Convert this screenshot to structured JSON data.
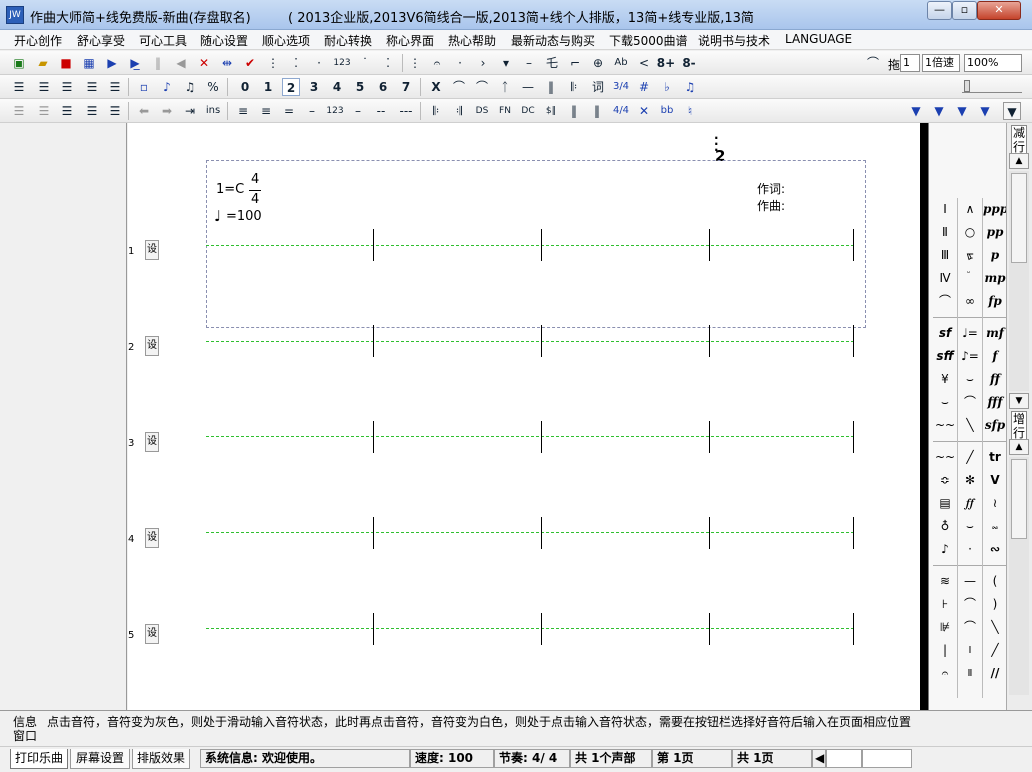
{
  "window": {
    "title": "作曲大师简+线免费版-新曲(存盘取名)",
    "title_extra": "( 2013企业版,2013V6简线合一版,2013简+线个人排版，13简+线专业版,13简",
    "controls": {
      "minimize": "—",
      "maximize": "▫",
      "close": "✕"
    },
    "icon_text": "JW"
  },
  "menu": [
    "开心创作",
    "舒心享受",
    "可心工具",
    "随心设置",
    "顺心选项",
    "耐心转换",
    "称心界面",
    "热心帮助",
    "最新动态与购买",
    "下载5000曲谱",
    "说明书与技术",
    "LANGUAGE"
  ],
  "toolbar1": {
    "drag_label": "拖",
    "drag_value": "1",
    "speed_value": "1倍速",
    "zoom_value": "100%",
    "buttons": [
      "123",
      "Ab",
      "8+",
      "8-"
    ]
  },
  "toolbar2": {
    "degrees": [
      "0",
      "1",
      "2",
      "3",
      "4",
      "5",
      "6",
      "7"
    ],
    "items": [
      "X",
      "词",
      "3/4",
      "#",
      "♭",
      "♫"
    ]
  },
  "toolbar3": {
    "items": [
      "ins",
      "123",
      "DS",
      "FN",
      "DC",
      "$‖",
      "4/4",
      "bb",
      "♮"
    ]
  },
  "score": {
    "page_number": "2",
    "key": "1=C",
    "time_num": "4",
    "time_den": "4",
    "tempo": "=100",
    "lyricist": "作词:",
    "composer": "作曲:",
    "rows": [
      {
        "num": "1",
        "set": "设"
      },
      {
        "num": "2",
        "set": "设"
      },
      {
        "num": "3",
        "set": "设"
      },
      {
        "num": "4",
        "set": "设"
      },
      {
        "num": "5",
        "set": "设"
      }
    ]
  },
  "palette": {
    "col1": [
      "Ⅰ",
      "Ⅱ",
      "Ⅲ",
      "Ⅳ",
      "⌒",
      "sf",
      "sff",
      "¥",
      "⌣",
      "~~",
      "~~",
      "≎",
      "▤",
      "♁",
      "♪",
      "≋",
      "⊦",
      "⊯",
      "|",
      "𝄐"
    ],
    "col2": [
      "∧",
      "○",
      "ᢘ",
      "𝆉",
      "∞",
      "♩=",
      "♪=",
      "⌣",
      "⌒",
      "╲",
      "╱",
      "✻",
      "𝆑𝆑",
      "⌣",
      "·",
      "—",
      "⌒",
      "⌒",
      "Ⅰ",
      "Ⅱ"
    ],
    "col3": [
      "ppp",
      "pp",
      "p",
      "mp",
      "fp",
      "mf",
      "f",
      "ff",
      "fff",
      "sfp",
      "tr",
      "V",
      "≀",
      "𝆗",
      "∾",
      "(",
      ")",
      "╲",
      "╱",
      "//"
    ]
  },
  "side_labels": {
    "reduce_row": "减行",
    "add_row": "增行"
  },
  "info": {
    "label": "信息",
    "text": "点击音符，音符变为灰色，则处于滑动输入音符状态，此时再点击音符，音符变为白色，则处于点击输入音符状态，需要在按钮栏选择好音符后输入在页面相应位置",
    "window_label": "窗口"
  },
  "status": {
    "tabs": [
      "打印乐曲",
      "屏幕设置",
      "排版效果"
    ],
    "system": "系统信息: 欢迎使用。",
    "speed": "速度: 100",
    "meter": "节奏: 4/ 4",
    "voices": "共 1个声部",
    "page": "第 1页",
    "total_pages": "共 1页"
  },
  "colors": {
    "staff_line": "#2fbf2f",
    "titlebar": "#b8d1f0",
    "close": "#c5432b"
  }
}
